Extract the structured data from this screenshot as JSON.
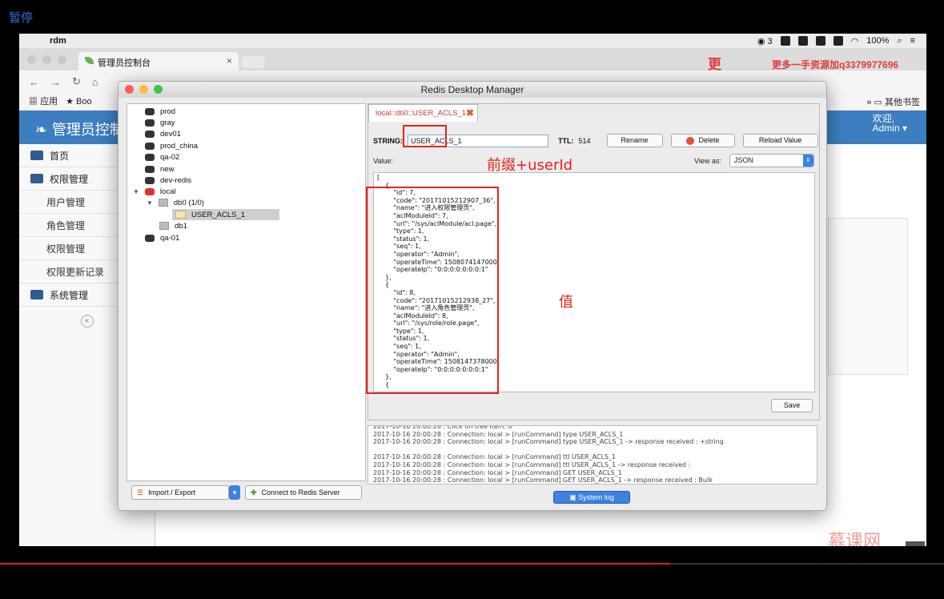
{
  "overlay": {
    "pause_label": "暂停",
    "progress_fraction": 0.71
  },
  "menubar": {
    "apple": "",
    "app_name": "rdm",
    "wechat_count": "3",
    "battery": "100%"
  },
  "browser": {
    "tab_title": "管理员控制台",
    "tab_close": "×",
    "watermark_big": "更",
    "watermark_small": "更多一手资源加q3379977696",
    "nav": {
      "back": "←",
      "forward": "→",
      "reload": "↻",
      "home": "⌂"
    },
    "bookmarks": {
      "apps": "应用",
      "book": "Boo",
      "other": "其他书签"
    }
  },
  "admin": {
    "title": "管理员控制台",
    "welcome": "欢迎,",
    "user": "Admin",
    "sidebar": [
      {
        "label": "首页",
        "sub": false
      },
      {
        "label": "权限管理",
        "sub": false
      },
      {
        "label": "用户管理",
        "sub": true
      },
      {
        "label": "角色管理",
        "sub": true
      },
      {
        "label": "权限管理",
        "sub": true
      },
      {
        "label": "权限更新记录",
        "sub": true
      },
      {
        "label": "系统管理",
        "sub": false
      }
    ],
    "collapse": "«",
    "logo": "慕课网",
    "scroll_top": "^"
  },
  "rdm": {
    "title": "Redis Desktop Manager",
    "tree": {
      "servers": [
        "prod",
        "gray",
        "dev01",
        "prod_china",
        "qa-02",
        "new",
        "dev-redis"
      ],
      "local": "local",
      "db0": "db0 (1/0)",
      "key": "USER_ACLS_1",
      "db1": "db1",
      "qa01": "qa-01"
    },
    "buttons": {
      "import_export": "Import / Export",
      "connect": "Connect to Redis Server",
      "rename": "Rename",
      "delete": "Delete",
      "reload": "Reload Value",
      "save": "Save",
      "system_log": "System log"
    },
    "key_tab": "local::db0::USER_ACLS_1",
    "type_label": "STRING:",
    "key_name": "USER_ACLS_1",
    "ttl_label": "TTL:",
    "ttl": "514",
    "value_label": "Value:",
    "view_as_label": "View as:",
    "view_as": "JSON",
    "value_text": "[\n    {\n        \"id\": 7,\n        \"code\": \"20171015212907_36\",\n        \"name\": \"进入权限管理页\",\n        \"aclModuleId\": 7,\n        \"url\": \"/sys/aclModule/acl.page\",\n        \"type\": 1,\n        \"status\": 1,\n        \"seq\": 1,\n        \"operator\": \"Admin\",\n        \"operateTime\": 1508074147000,\n        \"operateIp\": \"0:0:0:0:0:0:0:1\"\n    },\n    {\n        \"id\": 8,\n        \"code\": \"20171015212938_27\",\n        \"name\": \"进入角色管理页\",\n        \"aclModuleId\": 8,\n        \"url\": \"/sys/role/role.page\",\n        \"type\": 1,\n        \"status\": 1,\n        \"seq\": 1,\n        \"operator\": \"Admin\",\n        \"operateTime\": 1508147378000,\n        \"operateIp\": \"0:0:0:0:0:0:0:1\"\n    },\n    {",
    "log_text": "2017-10-16 20:00:28 : Click on tree item: 0\n2017-10-16 20:00:28 : Connection: local > [runCommand] type USER_ACLS_1\n2017-10-16 20:00:28 : Connection: local > [runCommand] type USER_ACLS_1 -> response received : +string\n\n2017-10-16 20:00:28 : Connection: local > [runCommand] ttl USER_ACLS_1\n2017-10-16 20:00:28 : Connection: local > [runCommand] ttl USER_ACLS_1 -> response received :\n2017-10-16 20:00:28 : Connection: local > [runCommand] GET USER_ACLS_1\n2017-10-16 20:00:28 : Connection: local > [runCommand] GET USER_ACLS_1 -> response received : Bulk"
  },
  "annotations": {
    "prefix": "前缀+userId",
    "value": "值"
  },
  "colors": {
    "accent": "#3c7ebf",
    "annotation": "#e5241b",
    "progress": "#d81f1f"
  }
}
